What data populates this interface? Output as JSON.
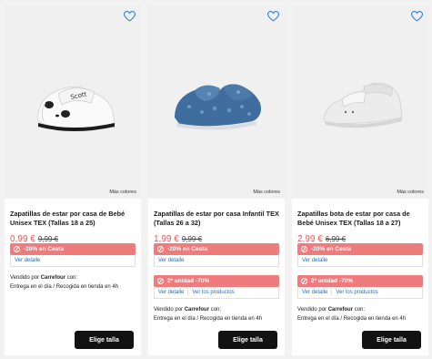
{
  "products": [
    {
      "title": "Zapatillas de estar por casa de Bebé Unisex TEX (Tallas 18 a 25)",
      "price": "0,99 €",
      "old_price": "9,99 €",
      "more_colors": "Más colores",
      "promos": [
        {
          "label": "-20% en Cesta",
          "links": [
            "Ver detalle"
          ]
        }
      ],
      "seller_prefix": "Vendido por ",
      "seller_name": "Carrefour",
      "seller_suffix": " con:",
      "delivery": "Entrega en el día / Recogida en tienda en 4h",
      "button": "Elige talla",
      "heart_icon": "heart-outline-icon"
    },
    {
      "title": "Zapatillas de estar por casa Infantil TEX (Tallas 26 a 32)",
      "price": "1,99 €",
      "old_price": "9,99 €",
      "more_colors": "Más colores",
      "promos": [
        {
          "label": "-20% en Cesta",
          "links": [
            "Ver detalle"
          ]
        },
        {
          "label": "2ª unidad -70%",
          "links": [
            "Ver detalle",
            "Ver los productos"
          ]
        }
      ],
      "seller_prefix": "Vendido por ",
      "seller_name": "Carrefour",
      "seller_suffix": " con:",
      "delivery": "Entrega en el día / Recogida en tienda en 4h",
      "button": "Elige talla",
      "heart_icon": "heart-outline-icon"
    },
    {
      "title": "Zapatillas bota de estar por casa de Bebé Unisex TEX (Tallas 18 a 27)",
      "price": "2,99 €",
      "old_price": "6,99 €",
      "more_colors": "Más colores",
      "promos": [
        {
          "label": "-20% en Cesta",
          "links": [
            "Ver detalle"
          ]
        },
        {
          "label": "2ª unidad -70%",
          "links": [
            "Ver detalle",
            "Ver los productos"
          ]
        }
      ],
      "seller_prefix": "Vendido por ",
      "seller_name": "Carrefour",
      "seller_suffix": " con:",
      "delivery": "Entrega en el día / Recogida en tienda en 4h",
      "button": "Elige talla",
      "heart_icon": "heart-outline-icon"
    }
  ],
  "colors": {
    "promo": "#ef7c7c",
    "price": "#ea5a5a",
    "link": "#1f6fc1",
    "button": "#121212",
    "heart": "#2f7fd8"
  }
}
